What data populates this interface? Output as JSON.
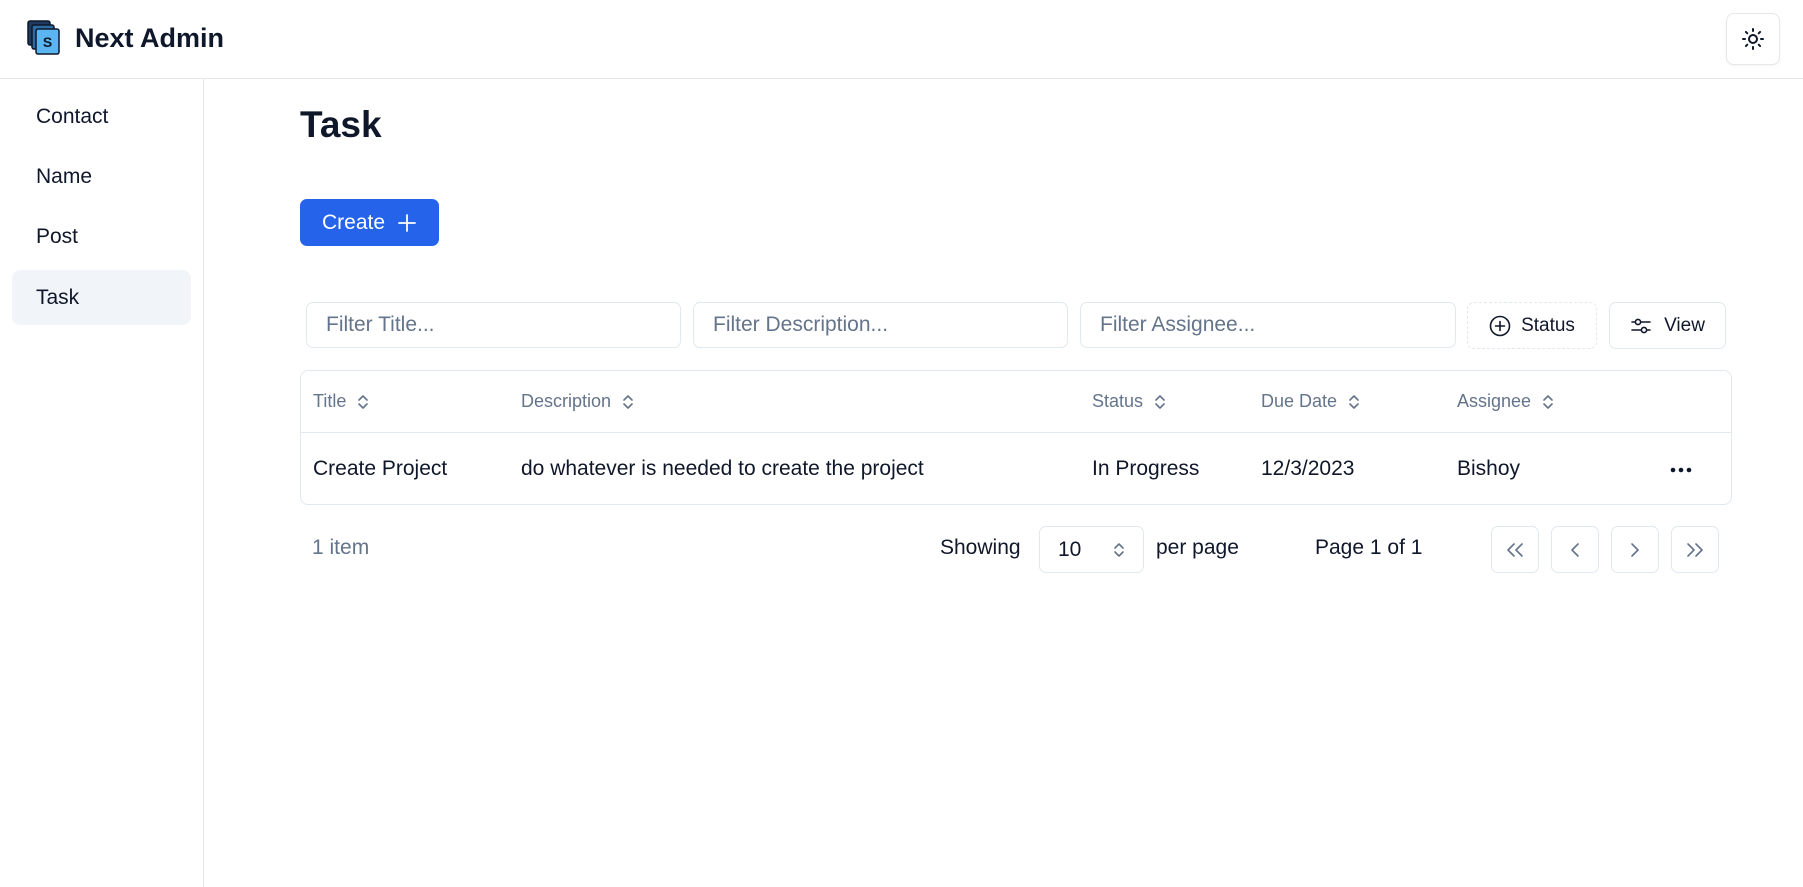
{
  "app": {
    "title": "Next Admin"
  },
  "header": {
    "theme_toggle_icon": "sun-icon"
  },
  "sidebar": {
    "items": [
      {
        "label": "Contact",
        "active": false
      },
      {
        "label": "Name",
        "active": false
      },
      {
        "label": "Post",
        "active": false
      },
      {
        "label": "Task",
        "active": true
      }
    ]
  },
  "main": {
    "title": "Task",
    "create_label": "Create",
    "filters": {
      "title_placeholder": "Filter Title...",
      "description_placeholder": "Filter Description...",
      "assignee_placeholder": "Filter Assignee...",
      "status_label": "Status",
      "view_label": "View"
    },
    "table": {
      "columns": [
        "Title",
        "Description",
        "Status",
        "Due Date",
        "Assignee"
      ],
      "rows": [
        {
          "title": "Create Project",
          "description": "do whatever is needed to create the project",
          "status": "In Progress",
          "due_date": "12/3/2023",
          "assignee": "Bishoy"
        }
      ]
    },
    "pagination": {
      "count_text": "1 item",
      "showing_label": "Showing",
      "page_size": "10",
      "per_page_label": "per page",
      "page_info": "Page 1 of 1"
    }
  },
  "colors": {
    "primary": "#2563eb",
    "border": "#e2e8f0",
    "muted_text": "#64748b",
    "active_nav_bg": "#f1f5f9"
  }
}
